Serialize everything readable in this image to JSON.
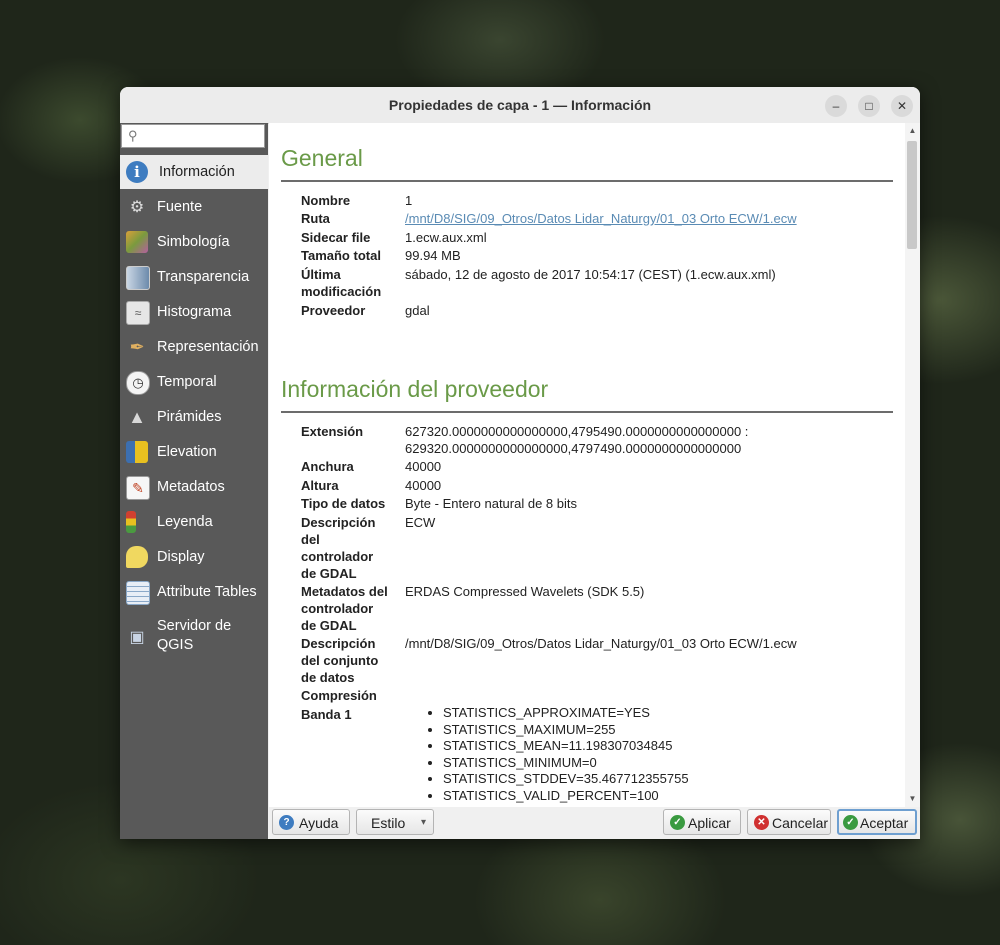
{
  "window": {
    "title": "Propiedades de capa - 1 — Información",
    "minimize": "–",
    "maximize": "□",
    "close": "✕"
  },
  "search": {
    "icon": "search-icon",
    "placeholder": ""
  },
  "sidebar": {
    "items": [
      {
        "label": "Información",
        "icon": "info-icon"
      },
      {
        "label": "Fuente",
        "icon": "wrench-icon"
      },
      {
        "label": "Simbología",
        "icon": "paint-icon"
      },
      {
        "label": "Transparencia",
        "icon": "transparency-icon"
      },
      {
        "label": "Histograma",
        "icon": "histogram-icon"
      },
      {
        "label": "Representación",
        "icon": "brush-icon"
      },
      {
        "label": "Temporal",
        "icon": "clock-icon"
      },
      {
        "label": "Pirámides",
        "icon": "pyramid-icon"
      },
      {
        "label": "Elevation",
        "icon": "elevation-icon"
      },
      {
        "label": "Metadatos",
        "icon": "metadata-icon"
      },
      {
        "label": "Leyenda",
        "icon": "legend-icon"
      },
      {
        "label": "Display",
        "icon": "display-icon"
      },
      {
        "label": "Attribute Tables",
        "icon": "table-icon"
      },
      {
        "label": "Servidor de\nQGIS",
        "icon": "server-icon"
      }
    ]
  },
  "general": {
    "heading": "General",
    "rows": [
      {
        "key": "Nombre",
        "value": "1"
      },
      {
        "key": "Ruta",
        "value": "/mnt/D8/SIG/09_Otros/Datos Lidar_Naturgy/01_03 Orto ECW/1.ecw"
      },
      {
        "key": "Sidecar file",
        "value": "1.ecw.aux.xml"
      },
      {
        "key": "Tamaño total",
        "value": "99.94 MB"
      },
      {
        "key": "Última\nmodificación",
        "value": "sábado, 12 de agosto de 2017 10:54:17 (CEST) (1.ecw.aux.xml)"
      },
      {
        "key": "Proveedor",
        "value": "gdal"
      }
    ]
  },
  "provider": {
    "heading": "Información del proveedor",
    "rows": [
      {
        "key": "Extensión",
        "value": "627320.0000000000000000,4795490.0000000000000000 :\n629320.0000000000000000,4797490.0000000000000000"
      },
      {
        "key": "Anchura",
        "value": "40000"
      },
      {
        "key": "Altura",
        "value": "40000"
      },
      {
        "key": "Tipo de datos",
        "value": "Byte - Entero natural de 8 bits"
      },
      {
        "key": "Descripción\ndel\ncontrolador\nde GDAL",
        "value": "ECW"
      },
      {
        "key": "Metadatos del\ncontrolador\nde GDAL",
        "value": "ERDAS Compressed Wavelets (SDK 5.5)"
      },
      {
        "key": "Descripción\ndel conjunto\nde datos",
        "value": "/mnt/D8/SIG/09_Otros/Datos Lidar_Naturgy/01_03 Orto ECW/1.ecw"
      },
      {
        "key": "Compresión",
        "value": ""
      },
      {
        "key": "Banda 1",
        "value": ""
      }
    ],
    "band1_stats": [
      "STATISTICS_APPROXIMATE=YES",
      "STATISTICS_MAXIMUM=255",
      "STATISTICS_MEAN=11.198307034845",
      "STATISTICS_MINIMUM=0",
      "STATISTICS_STDDEV=35.467712355755",
      "STATISTICS_VALID_PERCENT=100"
    ]
  },
  "footer": {
    "help": "Ayuda",
    "style": "Estilo",
    "style_arrow": "▾",
    "apply": "Aplicar",
    "cancel": "Cancelar",
    "ok": "Aceptar"
  },
  "colors": {
    "section_heading": "#6a9a48",
    "sidebar_bg": "#595959",
    "link": "#5a8bb4"
  }
}
